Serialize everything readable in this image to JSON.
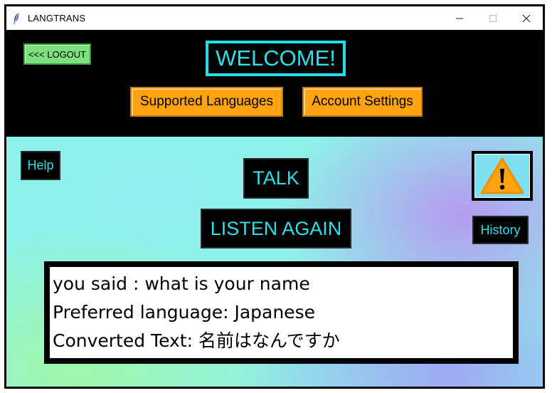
{
  "window": {
    "title": "LANGTRANS",
    "controls": {
      "minimize": "—",
      "maximize": "☐",
      "close": "✕"
    }
  },
  "header": {
    "logout_label": "<<< LOGOUT",
    "welcome_text": "WELCOME!",
    "supported_languages_label": "Supported Languages",
    "account_settings_label": "Account Settings"
  },
  "main": {
    "help_label": "Help",
    "talk_label": "TALK",
    "listen_again_label": "LISTEN AGAIN",
    "history_label": "History",
    "alert_icon": "warning-icon",
    "output_lines": [
      "you said : what is your name",
      "Preferred language: Japanese",
      "Converted Text: 名前はなんですか"
    ]
  },
  "colors": {
    "accent_cyan": "#2ce0ea",
    "orange": "#ffa310",
    "logout_green": "#7fe07f",
    "header_bg": "#000000"
  }
}
